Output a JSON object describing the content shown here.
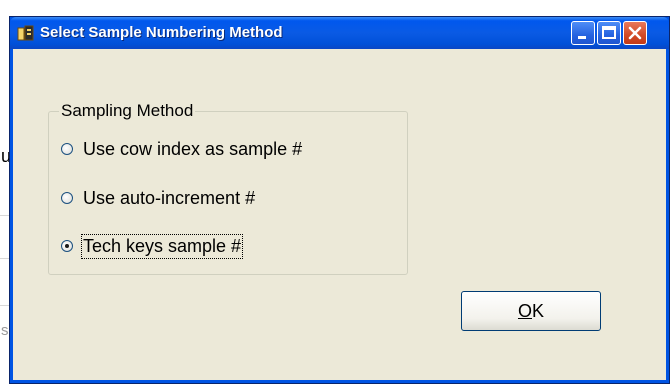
{
  "window": {
    "title": "Select Sample Numbering Method",
    "app_icon": "app-icon",
    "controls": [
      "minimize-icon",
      "maximize-icon",
      "close-icon"
    ]
  },
  "group": {
    "label": "Sampling Method",
    "options": [
      {
        "label": "Use cow index as sample #",
        "checked": false
      },
      {
        "label": "Use auto-increment #",
        "checked": false
      },
      {
        "label": "Tech keys sample #",
        "checked": true
      }
    ]
  },
  "ok_button": {
    "mnemonic": "O",
    "rest": "K"
  },
  "background": {
    "char_1": "u",
    "char_2": "s"
  },
  "colors": {
    "titlebar": "#0058ee",
    "client": "#ece9d8",
    "close": "#d24a26"
  }
}
